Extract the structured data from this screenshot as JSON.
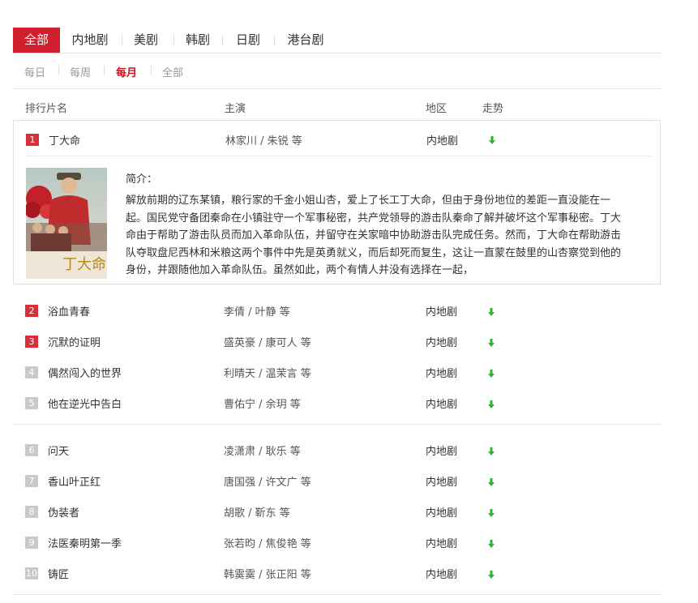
{
  "tabs": [
    "全部",
    "内地剧",
    "美剧",
    "韩剧",
    "日剧",
    "港台剧"
  ],
  "subtabs": [
    "每日",
    "每周",
    "每月",
    "全部"
  ],
  "columns": {
    "title": "排行片名",
    "actors": "主演",
    "region": "地区",
    "trend": "走势"
  },
  "expanded": {
    "rank": "1",
    "title": "丁大命",
    "actors": "林家川 / 朱锐 等",
    "region": "内地剧",
    "intro_label": "简介：",
    "poster_title": "丁大命",
    "intro": "解放前期的辽东某镇，粮行家的千金小姐山杏，爱上了长工丁大命，但由于身份地位的差距一直没能在一起。国民党守备团秦命在小镇驻守一个军事秘密，共产党领导的游击队秦命了解并破坏这个军事秘密。丁大命由于帮助了游击队员而加入革命队伍，并留守在关家暗中协助游击队完成任务。然而，丁大命在帮助游击队夺取盘尼西林和米粮这两个事件中先是英勇就义，而后却死而复生，这让一直蒙在鼓里的山杏察觉到他的身份，并跟随他加入革命队伍。虽然如此，两个有情人并没有选择在一起，"
  },
  "rows": [
    {
      "rank": "2",
      "title": "浴血青春",
      "actors": "李倩 / 叶静 等",
      "region": "内地剧"
    },
    {
      "rank": "3",
      "title": "沉默的证明",
      "actors": "盛英豪 / 康可人 等",
      "region": "内地剧"
    },
    {
      "rank": "4",
      "title": "偶然闯入的世界",
      "actors": "利晴天 / 温茉言 等",
      "region": "内地剧"
    },
    {
      "rank": "5",
      "title": "他在逆光中告白",
      "actors": "曹佑宁 / 余玥 等",
      "region": "内地剧"
    },
    {
      "rank": "6",
      "title": "问天",
      "actors": "凌潇肃 / 耿乐 等",
      "region": "内地剧"
    },
    {
      "rank": "7",
      "title": "香山叶正红",
      "actors": "唐国强 / 许文广 等",
      "region": "内地剧"
    },
    {
      "rank": "8",
      "title": "伪装者",
      "actors": "胡歌 / 靳东 等",
      "region": "内地剧"
    },
    {
      "rank": "9",
      "title": "法医秦明第一季",
      "actors": "张若昀 / 焦俊艳 等",
      "region": "内地剧"
    },
    {
      "rank": "10",
      "title": "铸匠",
      "actors": "韩霙霙 / 张正阳 等",
      "region": "内地剧"
    }
  ],
  "colors": {
    "accent": "#d0202e",
    "trend_down": "#2db52d",
    "rank_inactive": "#c9c9c9"
  },
  "icons": {
    "trend": "arrow-down-icon"
  }
}
